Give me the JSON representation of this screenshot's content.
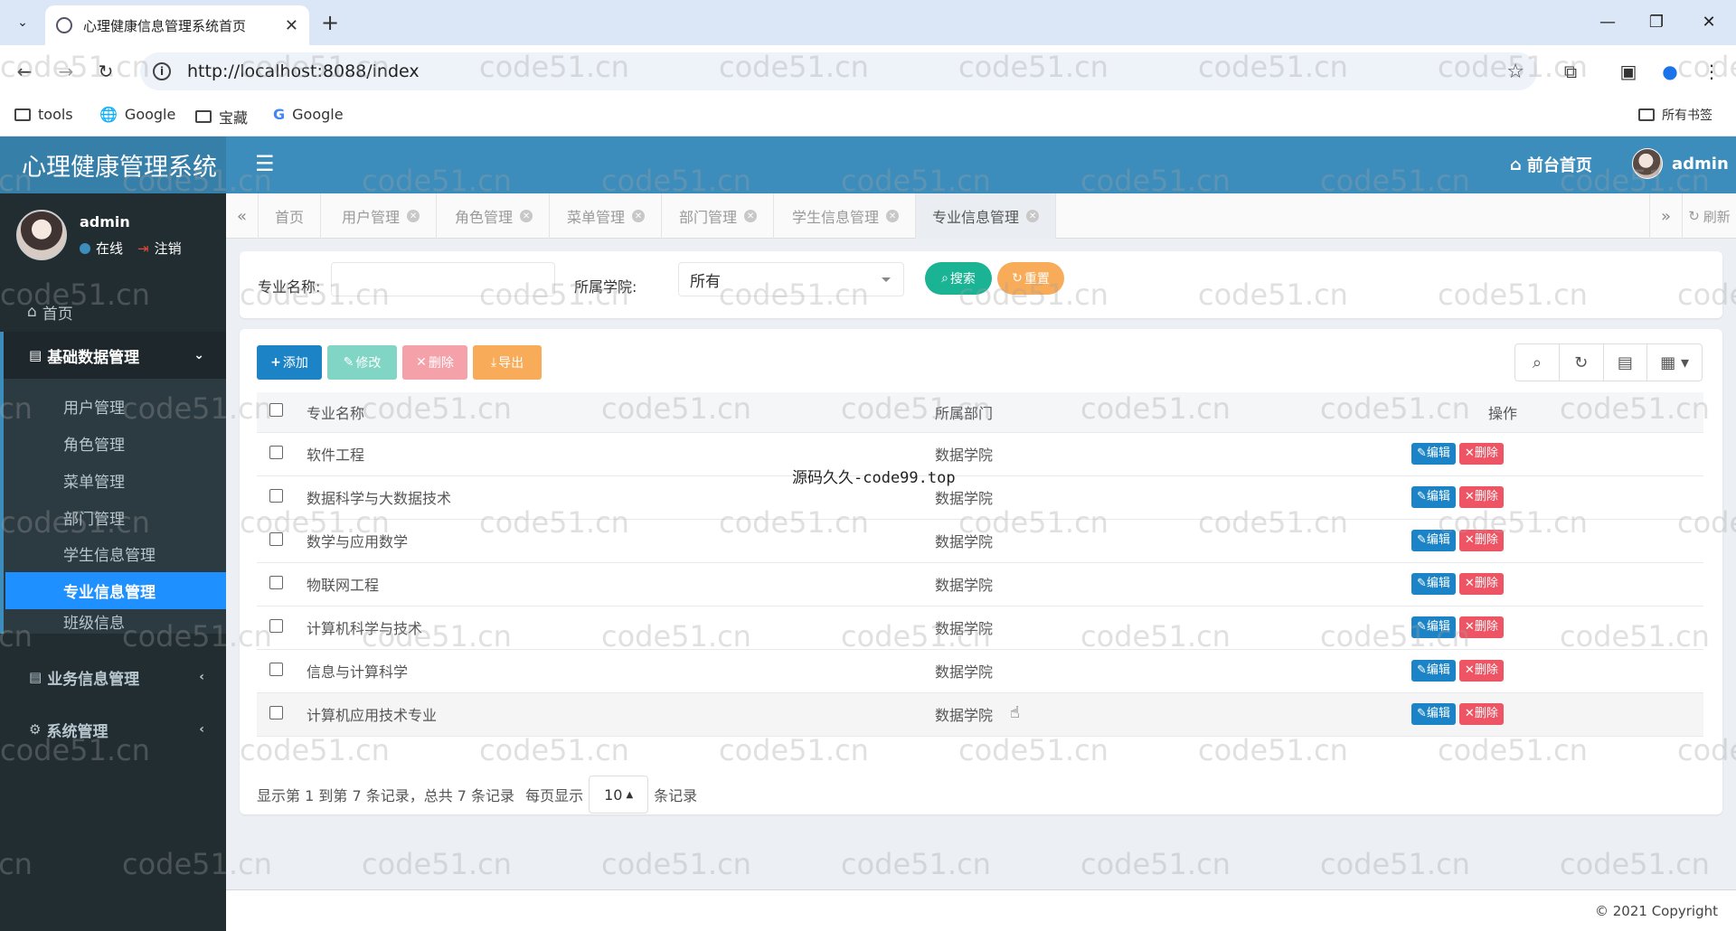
{
  "browser": {
    "tab_title": "心理健康信息管理系统首页",
    "url": "http://localhost:8088/index",
    "bookmarks": [
      "tools",
      "Google",
      "宝藏",
      "Google"
    ],
    "all_bookmarks": "所有书签"
  },
  "header": {
    "logo": "心理健康管理系统",
    "front_home": "前台首页",
    "user": "admin"
  },
  "sidebar": {
    "user_name": "admin",
    "online": "在线",
    "logout": "注销",
    "home": "首页",
    "group_basic": "基础数据管理",
    "items": [
      "用户管理",
      "角色管理",
      "菜单管理",
      "部门管理",
      "学生信息管理",
      "专业信息管理",
      "班级信息"
    ],
    "group_business": "业务信息管理",
    "group_system": "系统管理"
  },
  "tabs": {
    "home": "首页",
    "items": [
      "用户管理",
      "角色管理",
      "菜单管理",
      "部门管理",
      "学生信息管理",
      "专业信息管理"
    ],
    "refresh": "刷新"
  },
  "search": {
    "name_label": "专业名称:",
    "college_label": "所属学院:",
    "college_value": "所有",
    "search_btn": "搜索",
    "reset_btn": "重置"
  },
  "toolbar": {
    "add": "添加",
    "edit": "修改",
    "delete": "删除",
    "export": "导出"
  },
  "table": {
    "columns": [
      "专业名称",
      "所属部门",
      "操作"
    ],
    "rows": [
      {
        "name": "软件工程",
        "dept": "数据学院"
      },
      {
        "name": "数据科学与大数据技术",
        "dept": "数据学院"
      },
      {
        "name": "数学与应用数学",
        "dept": "数据学院"
      },
      {
        "name": "物联网工程",
        "dept": "数据学院"
      },
      {
        "name": "计算机科学与技术",
        "dept": "数据学院"
      },
      {
        "name": "信息与计算科学",
        "dept": "数据学院"
      },
      {
        "name": "计算机应用技术专业",
        "dept": "数据学院"
      }
    ],
    "edit_label": "编辑",
    "delete_label": "删除"
  },
  "pager": {
    "summary": "显示第 1 到第 7 条记录，总共 7 条记录",
    "per_page": "每页显示",
    "page_size": "10",
    "records": "条记录"
  },
  "footer": {
    "copyright": "© 2021 Copyright"
  },
  "overlay": {
    "center_note": "源码久久-code99.top",
    "watermark": "code51.cn"
  },
  "colors": {
    "header": "#3c8dbc",
    "sidebar": "#222d32",
    "active_menu": "#1e90ff",
    "primary": "#1c84c6",
    "danger": "#ed5565",
    "success": "#1ab394",
    "warning": "#f8ac59"
  }
}
